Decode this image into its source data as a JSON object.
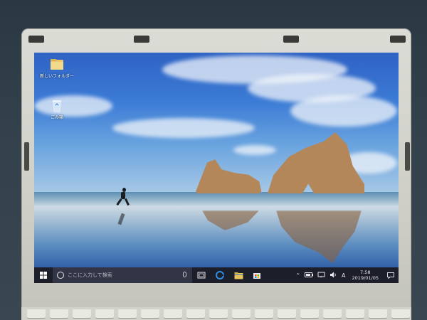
{
  "desktop": {
    "icons": [
      {
        "label": "新しいフォルダー",
        "icon": "folder-icon"
      },
      {
        "label": "ごみ箱",
        "icon": "recycle-bin-icon"
      }
    ]
  },
  "taskbar": {
    "search_placeholder": "ここに入力して検索",
    "apps": [
      {
        "icon": "task-view-icon"
      },
      {
        "icon": "edge-icon"
      },
      {
        "icon": "file-explorer-icon"
      },
      {
        "icon": "store-icon"
      }
    ],
    "tray": {
      "input_indicator": "A",
      "time": "7:58",
      "date": "2019/01/05"
    }
  },
  "colors": {
    "taskbar": "#1c1e2a",
    "search_box": "#323545",
    "bezel": "#d6d6cf",
    "edge_blue": "#2f8fe6"
  }
}
